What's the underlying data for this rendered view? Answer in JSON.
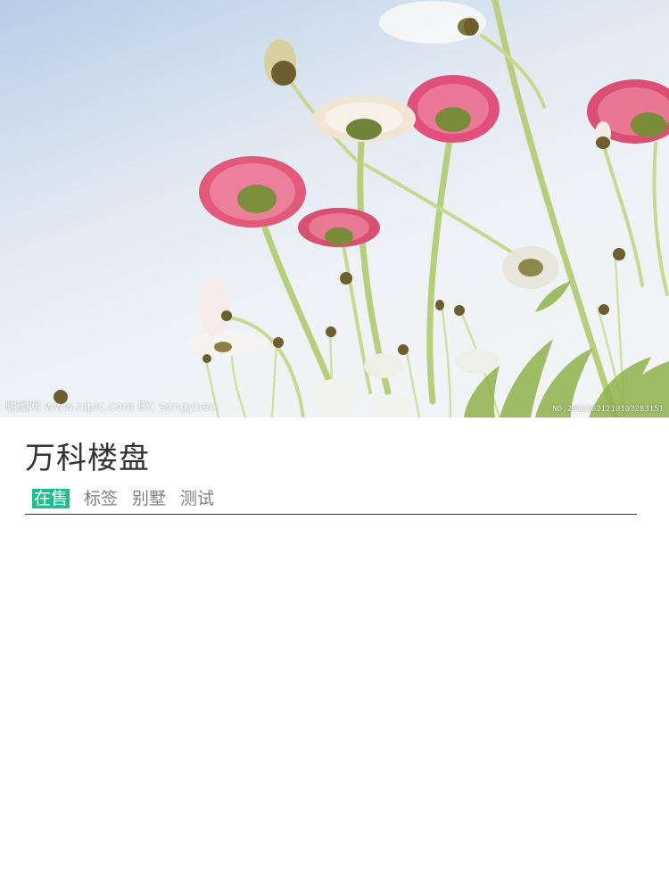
{
  "hero": {
    "image_description": "flowers-photo",
    "watermark_left": "昵图网 www.nipic.com   BY: songyuec",
    "watermark_right": "NO:20111021210103283151"
  },
  "listing": {
    "title": "万科楼盘",
    "status_tag": "在售",
    "tags": [
      "标签",
      "别墅",
      "测试"
    ]
  },
  "colors": {
    "status_tag_bg": "#1dbf8e",
    "title_text": "#333333",
    "tag_text": "#808080",
    "divider": "#333333"
  }
}
